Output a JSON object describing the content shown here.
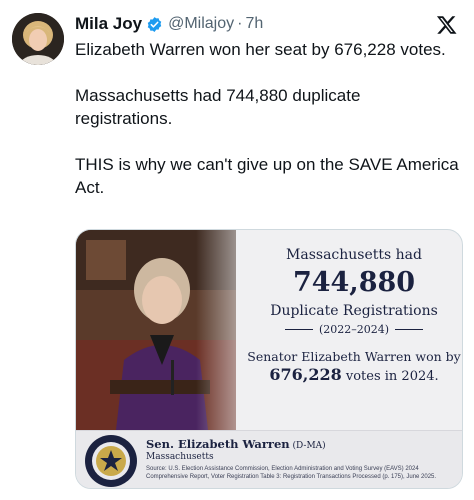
{
  "author": {
    "name": "Mila Joy",
    "handle": "@Milajoy",
    "separator": "·",
    "time": "7h",
    "verified_color": "#1d9bf0",
    "avatar_icon": "avatar-photo"
  },
  "tweet": {
    "paragraphs": [
      "Elizabeth Warren won her seat by 676,228 votes.",
      "Massachusetts had 744,880 duplicate registrations.",
      "THIS is why we can't give up on the SAVE America Act."
    ]
  },
  "graphic": {
    "line1": "Massachusetts had",
    "number": "744,880",
    "line2": "Duplicate Registrations",
    "years": "(2022–2024)",
    "senator_line": "Senator Elizabeth Warren won by",
    "votes_number": "676,228",
    "votes_suffix": " votes in 2024.",
    "caption_name": "Sen. Elizabeth Warren",
    "caption_party": " (D-MA)",
    "caption_state": "Massachusetts",
    "source": "Source: U.S. Election Assistance Commission, Election Administration and Voting Survey (EAVS) 2024 Comprehensive Report, Voter Registration Table 3: Registration Transactions Processed (p. 175), June 2025.",
    "seal_text_top": "UNITED STATES",
    "seal_text_bottom": "SENATE",
    "accent_color": "#1b2240"
  }
}
